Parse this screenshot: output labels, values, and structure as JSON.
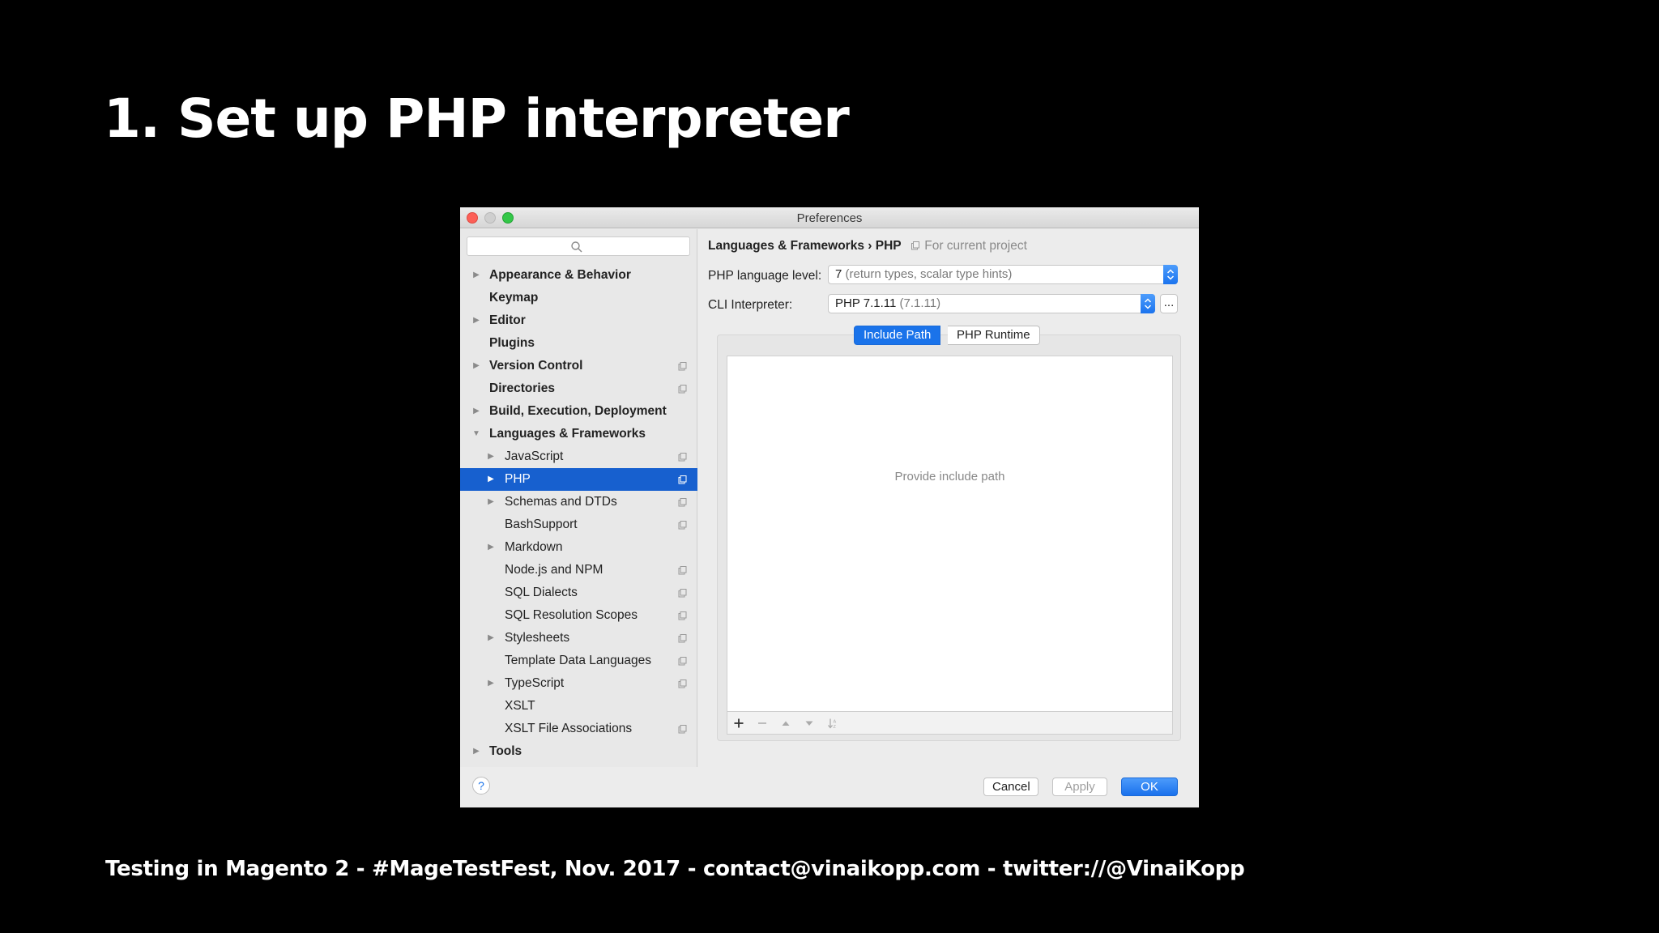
{
  "slide": {
    "title": "1. Set up PHP interpreter",
    "footer": "Testing in Magento 2 - #MageTestFest, Nov. 2017 - contact@vinaikopp.com - twitter://@VinaiKopp"
  },
  "window": {
    "title": "Preferences"
  },
  "sidebar": {
    "search_placeholder": "",
    "items": [
      {
        "label": "Appearance & Behavior",
        "level": 0,
        "arrow": "collapsed",
        "project_icon": false
      },
      {
        "label": "Keymap",
        "level": 0,
        "arrow": "none",
        "project_icon": false
      },
      {
        "label": "Editor",
        "level": 0,
        "arrow": "collapsed",
        "project_icon": false
      },
      {
        "label": "Plugins",
        "level": 0,
        "arrow": "none",
        "project_icon": false
      },
      {
        "label": "Version Control",
        "level": 0,
        "arrow": "collapsed",
        "project_icon": true
      },
      {
        "label": "Directories",
        "level": 0,
        "arrow": "none",
        "project_icon": true
      },
      {
        "label": "Build, Execution, Deployment",
        "level": 0,
        "arrow": "collapsed",
        "project_icon": false
      },
      {
        "label": "Languages & Frameworks",
        "level": 0,
        "arrow": "expanded",
        "project_icon": false
      },
      {
        "label": "JavaScript",
        "level": 1,
        "arrow": "collapsed",
        "project_icon": true
      },
      {
        "label": "PHP",
        "level": 1,
        "arrow": "collapsed",
        "project_icon": true,
        "selected": true
      },
      {
        "label": "Schemas and DTDs",
        "level": 1,
        "arrow": "collapsed",
        "project_icon": true
      },
      {
        "label": "BashSupport",
        "level": 1,
        "arrow": "none",
        "project_icon": true
      },
      {
        "label": "Markdown",
        "level": 1,
        "arrow": "collapsed",
        "project_icon": false
      },
      {
        "label": "Node.js and NPM",
        "level": 1,
        "arrow": "none",
        "project_icon": true
      },
      {
        "label": "SQL Dialects",
        "level": 1,
        "arrow": "none",
        "project_icon": true
      },
      {
        "label": "SQL Resolution Scopes",
        "level": 1,
        "arrow": "none",
        "project_icon": true
      },
      {
        "label": "Stylesheets",
        "level": 1,
        "arrow": "collapsed",
        "project_icon": true
      },
      {
        "label": "Template Data Languages",
        "level": 1,
        "arrow": "none",
        "project_icon": true
      },
      {
        "label": "TypeScript",
        "level": 1,
        "arrow": "collapsed",
        "project_icon": true
      },
      {
        "label": "XSLT",
        "level": 1,
        "arrow": "none",
        "project_icon": false
      },
      {
        "label": "XSLT File Associations",
        "level": 1,
        "arrow": "none",
        "project_icon": true
      },
      {
        "label": "Tools",
        "level": 0,
        "arrow": "collapsed",
        "project_icon": false
      }
    ]
  },
  "content": {
    "breadcrumb": {
      "section": "Languages & Frameworks",
      "separator": "›",
      "page": "PHP",
      "scope_note": "For current project"
    },
    "language_level": {
      "label": "PHP language level:",
      "value": "7",
      "value_detail": "(return types, scalar type hints)"
    },
    "cli_interpreter": {
      "label": "CLI Interpreter:",
      "value": "PHP 7.1.11",
      "value_detail": "(7.1.11)",
      "more_label": "..."
    },
    "tabs": [
      {
        "label": "Include Path",
        "active": true
      },
      {
        "label": "PHP Runtime",
        "active": false
      }
    ],
    "include_path_placeholder": "Provide include path"
  },
  "buttons": {
    "help": "?",
    "cancel": "Cancel",
    "apply": "Apply",
    "ok": "OK"
  },
  "colors": {
    "selection": "#1760cf",
    "accent": "#1a73ea",
    "background": "#000000"
  }
}
